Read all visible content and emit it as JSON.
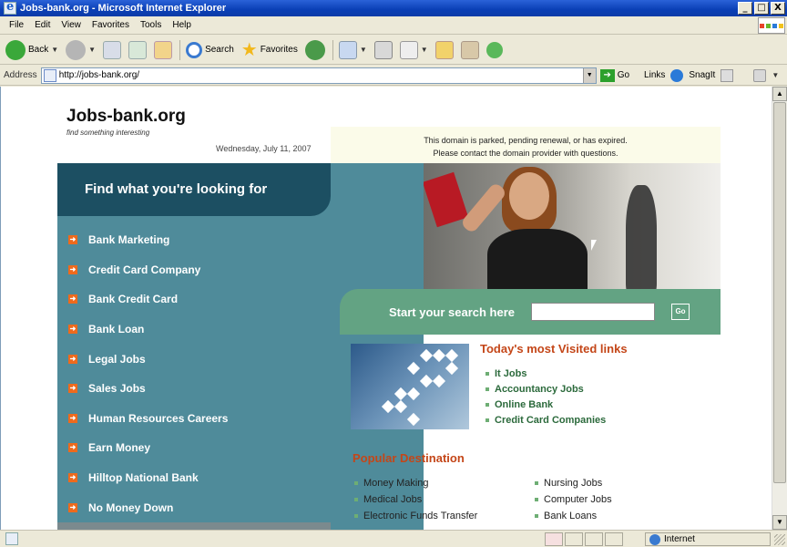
{
  "window": {
    "title": "Jobs-bank.org - Microsoft Internet Explorer",
    "minimize": "_",
    "maximize": "□",
    "close": "X"
  },
  "menu": [
    "File",
    "Edit",
    "View",
    "Favorites",
    "Tools",
    "Help"
  ],
  "toolbar": {
    "back_label": "Back",
    "search_label": "Search",
    "favorites_label": "Favorites"
  },
  "address": {
    "label": "Address",
    "url": "http://jobs-bank.org/",
    "go_label": "Go",
    "links_label": "Links",
    "snagit_label": "SnagIt"
  },
  "page": {
    "logo": "Jobs-bank.org",
    "tagline": "find something interesting",
    "date": "Wednesday, July 11, 2007",
    "notice_line1": "This domain is parked, pending renewal, or has expired.",
    "notice_line2": "Please contact the domain provider with questions.",
    "find_header": "Find what you're looking for",
    "categories": [
      "Bank Marketing",
      "Credit Card Company",
      "Bank Credit Card",
      "Bank Loan",
      "Legal Jobs",
      "Sales Jobs",
      "Human Resources Careers",
      "Earn Money",
      "Hilltop National Bank",
      "No Money Down"
    ],
    "search_prompt": "Start your search here",
    "search_go": "Go",
    "visited_title": "Today's most Visited links",
    "visited_links": [
      "It Jobs",
      "Accountancy Jobs",
      "Online Bank",
      "Credit Card Companies"
    ],
    "popular_title": "Popular Destination",
    "popular_left": [
      "Money Making",
      "Medical Jobs",
      "Electronic Funds Transfer"
    ],
    "popular_right": [
      "Nursing Jobs",
      "Computer Jobs",
      "Bank Loans"
    ]
  },
  "status": {
    "zone": "Internet"
  }
}
